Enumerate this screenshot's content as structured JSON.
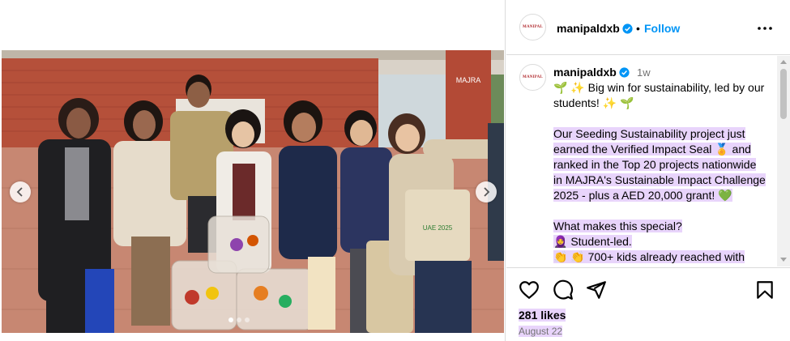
{
  "header": {
    "username": "manipaldxb",
    "follow_label": "Follow",
    "separator": "•",
    "avatar_text": "MANIPAL"
  },
  "caption": {
    "username": "manipaldxb",
    "time": "1w",
    "line1": "🌱 ✨ Big win for sustainability, led by our students! ✨ 🌱",
    "para2": "Our Seeding Sustainability project just earned the Verified Impact Seal 🏅 and ranked in the Top 20 projects nationwide in MAJRA's Sustainable Impact Challenge 2025 - plus a AED 20,000 grant! 💚",
    "heading3": "What makes this special?",
    "bullet1": "🧕 Student-led.",
    "bullet2_partial": "👏 👏 700+ kids already reached with"
  },
  "photo": {
    "bag_text": "UAE 2025",
    "wall_logo": "MAJRA",
    "dots_count": 3
  },
  "engagement": {
    "likes": "281 likes",
    "date": "August 22"
  },
  "colors": {
    "follow_blue": "#0095f6",
    "verified_blue": "#0095f6",
    "highlight": "#e8d4fb",
    "border": "#dbdbdb",
    "meta_gray": "#737373"
  }
}
